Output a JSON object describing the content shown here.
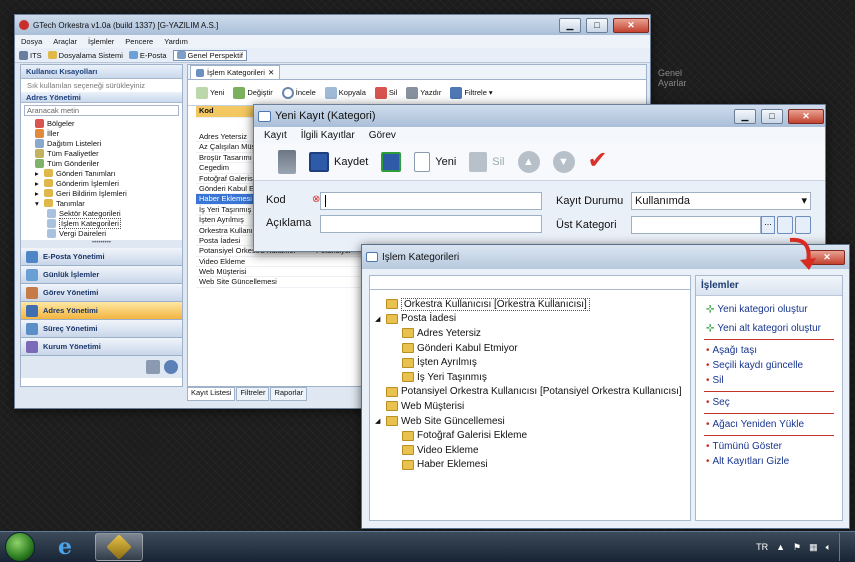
{
  "main": {
    "title": "GTech Orkestra v1.0a (build 1337) [G-YAZILIM A.S.]",
    "menu": [
      "Dosya",
      "Araçlar",
      "İşlemler",
      "Pencere",
      "Yardım"
    ],
    "perspective": [
      "ITS",
      "Dosyalama Sistemi",
      "E-Posta",
      "Genel Perspektif"
    ],
    "left": {
      "shortcuts_header": "Kullanıcı Kısayolları",
      "shortcuts_hint": "Sık kullanılan seçeneği sürükleyiniz",
      "section": "Adres Yönetimi",
      "search_placeholder": "Aranacak metin",
      "items": [
        "Bölgeler",
        "İller",
        "Dağıtım Listeleri",
        "Tüm Faaliyetler",
        "Tüm Gönderiler",
        "Gönderi Tanımları",
        "Gönderim İşlemleri",
        "Geri Bildirim İşlemleri",
        "Tanımlar",
        "Sektör Kategorileri",
        "İşlem Kategorileri",
        "Vergi Daireleri"
      ],
      "nav": [
        "E-Posta Yönetimi",
        "Günlük İşlemler",
        "Görev Yönetimi",
        "Adres Yönetimi",
        "Süreç Yönetimi",
        "Kurum Yönetimi"
      ]
    },
    "tab": "İşlem Kategorileri",
    "toolbar": [
      "Yeni",
      "Değiştir",
      "İncele",
      "Kopyala",
      "Sil",
      "Yazdır",
      "Filtrele"
    ],
    "grid": {
      "header": "Kod",
      "rows": [
        "Adres Yetersiz",
        "Az Çalışılan Müşteri",
        "Broşür Tasarımı",
        "Cegedim",
        "Fotoğraf Galerisi",
        "Gönderi Kabul Et",
        "Haber Eklemesi",
        "İş Yeri Taşınmış",
        "İşten Ayrılmış",
        "Orkestra Kullanıcı",
        "Posta İadesi",
        "Potansiyel Orkestra Kullanıcı",
        "Video Ekleme",
        "Web Müşterisi",
        "Web Site Güncellemesi"
      ],
      "row_b": "Potansiyel"
    },
    "bottom_tabs": [
      "Kayıt Listesi",
      "Filtreler",
      "Raporlar"
    ],
    "bg_tab": "Genel Ayarlar"
  },
  "dialog": {
    "title": "Yeni Kayıt (Kategori)",
    "menu": [
      "Kayıt",
      "İlgili Kayıtlar",
      "Görev"
    ],
    "toolbar": {
      "save": "Kaydet",
      "new": "Yeni",
      "delete": "Sil"
    },
    "fields": {
      "kod": "Kod",
      "aciklama": "Açıklama",
      "kayit_durumu": "Kayıt Durumu",
      "kayit_durumu_value": "Kullanımda",
      "ust_kategori": "Üst Kategori",
      "dots": "..."
    }
  },
  "islem": {
    "title": "İşlem Kategorileri",
    "tree": [
      {
        "label": "Orkestra Kullanıcısı [Orkestra Kullanıcısı]",
        "level": 0
      },
      {
        "label": "Posta İadesi",
        "level": 0,
        "expand": "◢"
      },
      {
        "label": "Adres Yetersiz",
        "level": 1
      },
      {
        "label": "Gönderi Kabul Etmiyor",
        "level": 1
      },
      {
        "label": "İşten Ayrılmış",
        "level": 1
      },
      {
        "label": "İş Yeri Taşınmış",
        "level": 1
      },
      {
        "label": "Potansiyel Orkestra Kullanıcısı [Potansiyel Orkestra Kullanıcısı]",
        "level": 0
      },
      {
        "label": "Web Müşterisi",
        "level": 0
      },
      {
        "label": "Web Site Güncellemesi",
        "level": 0,
        "expand": "◢"
      },
      {
        "label": "Fotoğraf Galerisi Ekleme",
        "level": 1
      },
      {
        "label": "Video Ekleme",
        "level": 1
      },
      {
        "label": "Haber Eklemesi",
        "level": 1
      }
    ],
    "side_header": "İşlemler",
    "actions": [
      [
        "Yeni kategori oluştur",
        "Yeni alt kategori oluştur"
      ],
      [
        "Aşağı taşı",
        "Seçili kaydı güncelle",
        "Sil"
      ],
      [
        "Seç"
      ],
      [
        "Ağacı Yeniden Yükle"
      ],
      [
        "Tümünü Göster",
        "Alt Kayıtları Gizle"
      ]
    ]
  },
  "taskbar": {
    "lang": "TR"
  },
  "colors": {
    "accent": "#f3b43f",
    "link": "#17358f",
    "selection": "#3875d6"
  }
}
